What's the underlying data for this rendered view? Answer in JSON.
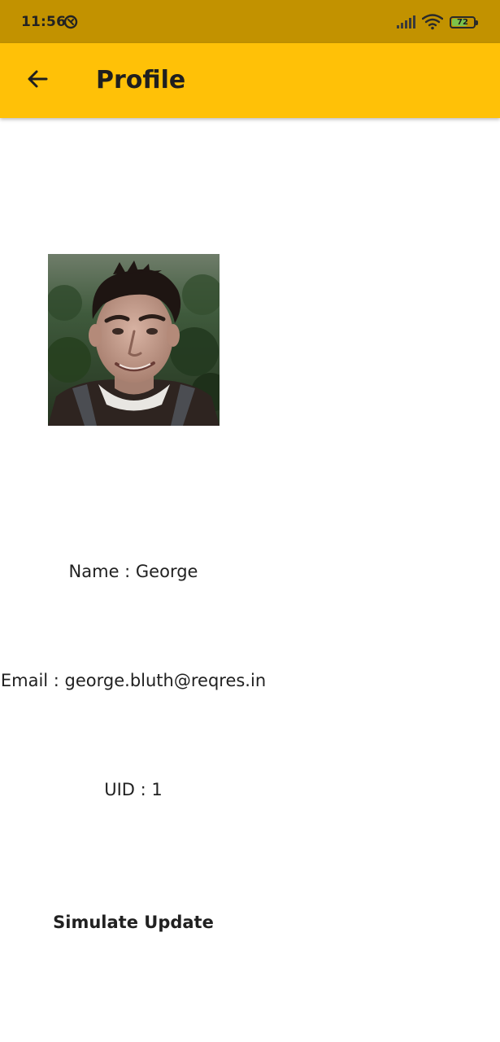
{
  "status_bar": {
    "time": "11:56",
    "battery_percent": 72,
    "battery_label": "72",
    "icons": [
      "sync-ring-icon",
      "signal-icon",
      "wifi-icon",
      "battery-icon"
    ],
    "background_color": "#C29200"
  },
  "app_bar": {
    "title": "Profile",
    "back_icon": "arrow-left-icon",
    "background_color": "#FFC107"
  },
  "profile": {
    "avatar_alt": "profile photo",
    "name_line": "Name : George",
    "email_line": "Email : george.bluth@reqres.in",
    "uid_line": "UID : 1"
  },
  "actions": {
    "simulate_update_label": "Simulate Update"
  }
}
